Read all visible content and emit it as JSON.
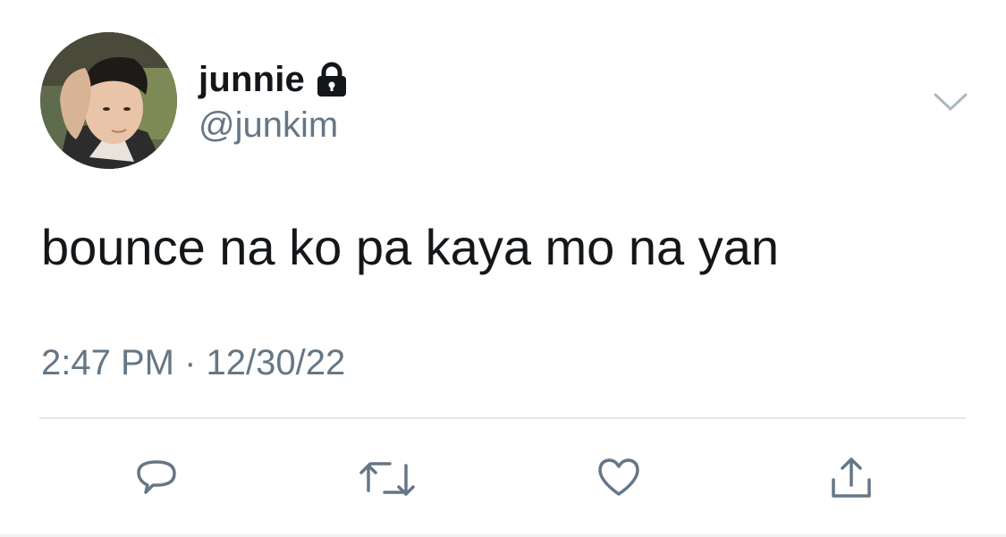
{
  "user": {
    "display_name": "junnie",
    "handle": "@junkim",
    "protected_icon": "lock-icon",
    "avatar": "profile-photo"
  },
  "tweet": {
    "text": "bounce na ko pa kaya mo na yan",
    "timestamp": "2:47 PM · 12/30/22"
  },
  "menu": {
    "icon": "chevron-down-icon"
  },
  "actions": [
    {
      "name": "reply",
      "icon": "speech-bubble-icon"
    },
    {
      "name": "retweet",
      "icon": "retweet-arrows-icon"
    },
    {
      "name": "like",
      "icon": "heart-icon"
    },
    {
      "name": "share",
      "icon": "share-upload-icon"
    }
  ],
  "colors": {
    "text_primary": "#14171a",
    "text_secondary": "#657786",
    "icon_gray": "#657786",
    "divider": "#e1e8ed"
  }
}
